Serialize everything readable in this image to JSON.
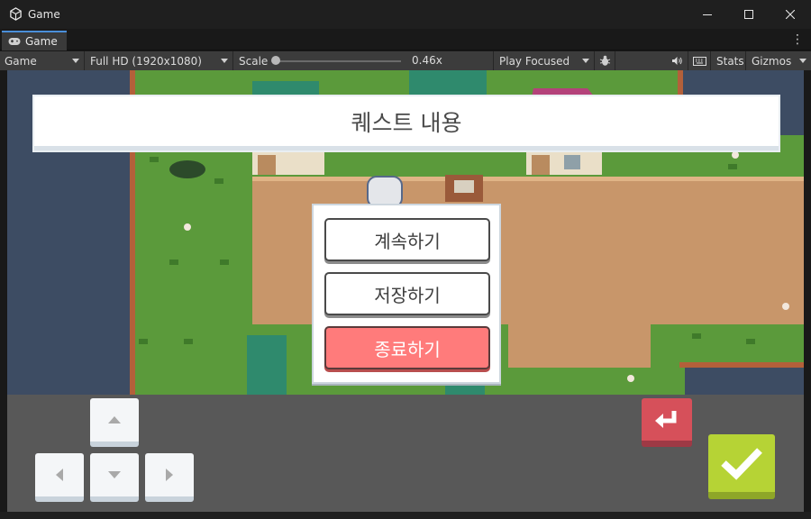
{
  "window": {
    "title": "Game"
  },
  "tab": {
    "label": "Game",
    "icon": "gamepad-icon"
  },
  "toolbar": {
    "display": "Game",
    "resolution": "Full HD (1920x1080)",
    "scale_label": "Scale",
    "scale_value": "0.46x",
    "play_mode": "Play Focused",
    "stats_label": "Stats",
    "gizmos_label": "Gizmos"
  },
  "game": {
    "quest_title": "퀘스트 내용",
    "menu": {
      "continue_label": "계속하기",
      "save_label": "저장하기",
      "quit_label": "종료하기"
    }
  },
  "colors": {
    "accent_tab": "#4a8fd9",
    "grass": "#5b9a3b",
    "dirt": "#c8966a",
    "quit_button": "#ff7b7b",
    "back_button": "#d6505a",
    "confirm_button": "#b6d335"
  }
}
